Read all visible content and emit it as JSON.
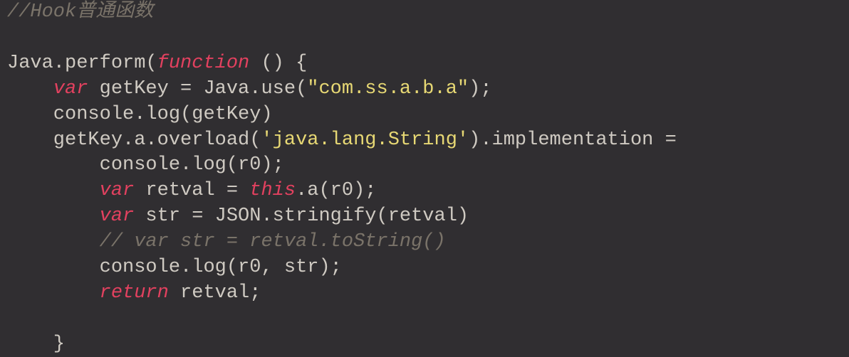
{
  "code": {
    "c0": "//Hook普通函数",
    "l1": {
      "t0": "Java.perform(",
      "t1": "function",
      "t2": " () {"
    },
    "l2": {
      "t0": "    ",
      "t1": "var",
      "t2": " getKey = Java.use(",
      "t3": "\"com.ss.a.b.a\"",
      "t4": ");"
    },
    "l3": {
      "t0": "    console.log(getKey)"
    },
    "l4": {
      "t0": "    getKey.a.overload(",
      "t1": "'java.lang.String'",
      "t2": ").implementation = "
    },
    "l5": {
      "t0": "        console.log(r0);"
    },
    "l6": {
      "t0": "        ",
      "t1": "var",
      "t2": " retval = ",
      "t3": "this",
      "t4": ".a(r0);"
    },
    "l7": {
      "t0": "        ",
      "t1": "var",
      "t2": " str = JSON.stringify(retval)"
    },
    "l8": {
      "t0": "        ",
      "t1": "// var str = retval.toString()"
    },
    "l9": {
      "t0": "        console.log(r0, str);"
    },
    "l10": {
      "t0": "        ",
      "t1": "return",
      "t2": " retval;"
    },
    "l11": {
      "t0": ""
    },
    "l12": {
      "t0": "    }"
    }
  }
}
